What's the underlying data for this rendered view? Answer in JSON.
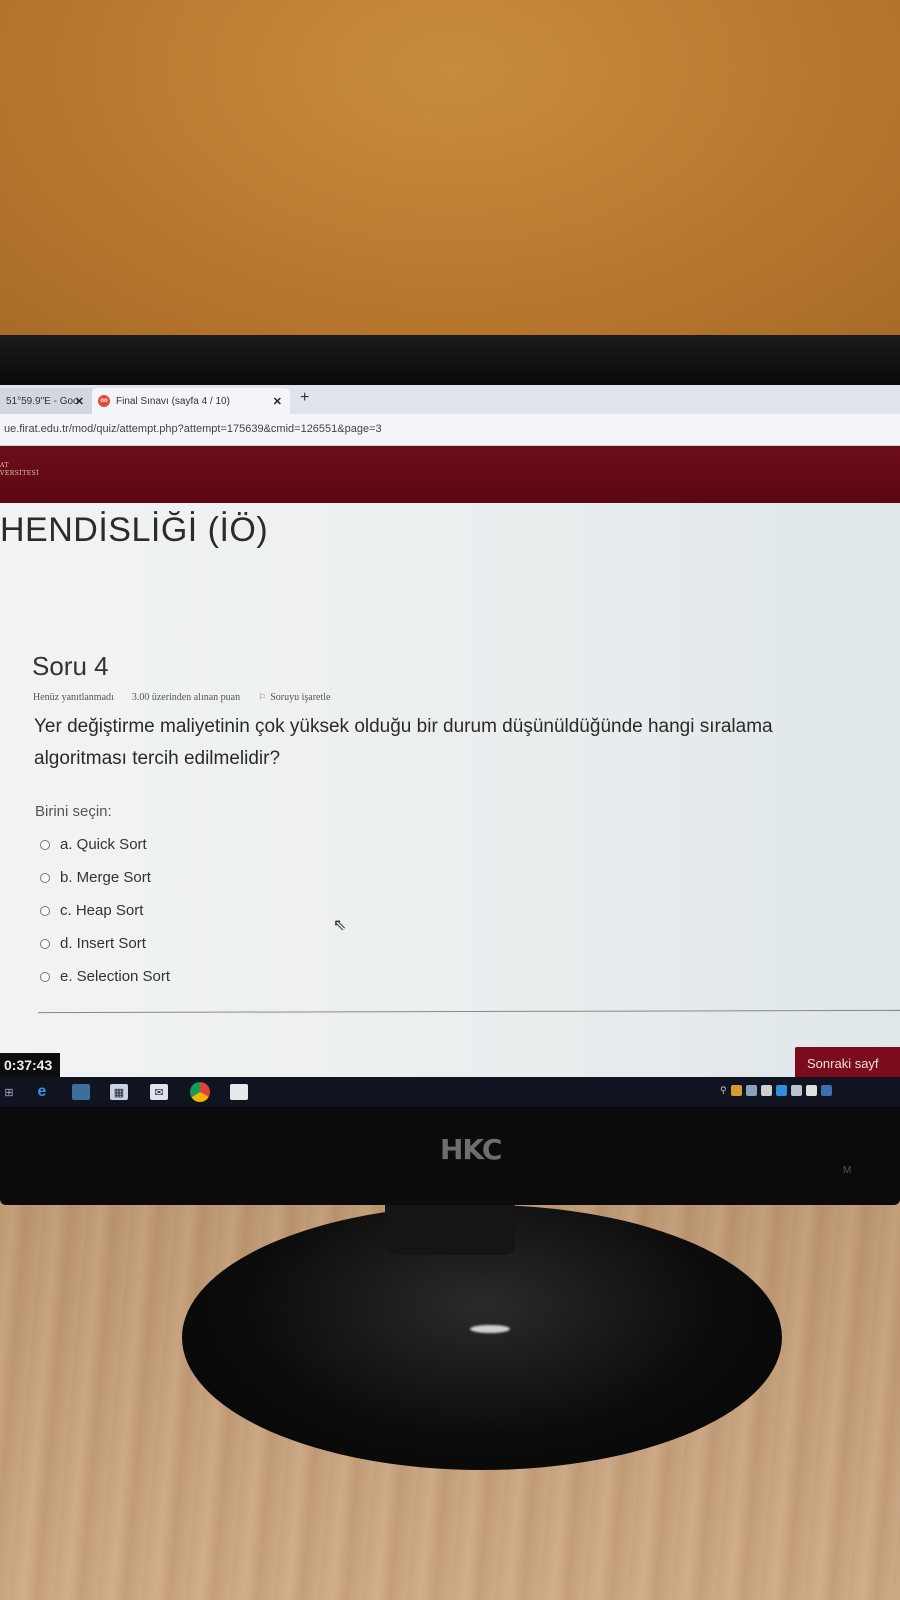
{
  "browser": {
    "tabs": [
      {
        "label": "51°59.9\"E - Goo",
        "active": false
      },
      {
        "label": "Final Sınavı (sayfa 4 / 10)",
        "active": true
      }
    ],
    "new_tab_icon": "plus-icon",
    "url": "ue.firat.edu.tr/mod/quiz/attempt.php?attempt=175639&cmid=126551&page=3"
  },
  "site": {
    "logo_text_line1": "AT",
    "logo_text_line2": "VERSİTESİ",
    "course_title": "HENDİSLİĞİ (İÖ)"
  },
  "question": {
    "number_label": "Soru 4",
    "status": "Henüz yanıtlanmadı",
    "points": "3.00 üzerinden alınan puan",
    "flag_label": "Soruyu işaretle",
    "text": "Yer değiştirme maliyetinin çok yüksek olduğu bir durum düşünüldüğünde hangi sıralama algoritması tercih edilmelidir?",
    "prompt": "Birini seçin:",
    "options": [
      {
        "label": "a. Quick Sort"
      },
      {
        "label": "b. Merge Sort"
      },
      {
        "label": "c. Heap Sort"
      },
      {
        "label": "d. Insert Sort"
      },
      {
        "label": "e. Selection Sort"
      }
    ]
  },
  "timer": "0:37:43",
  "next_button": "Sonraki sayf",
  "monitor": {
    "brand": "HKC",
    "bezel_label": "M"
  },
  "colors": {
    "header": "#6d0d1a",
    "next_button": "#7a0c1c",
    "taskbar": "#0f1420"
  }
}
